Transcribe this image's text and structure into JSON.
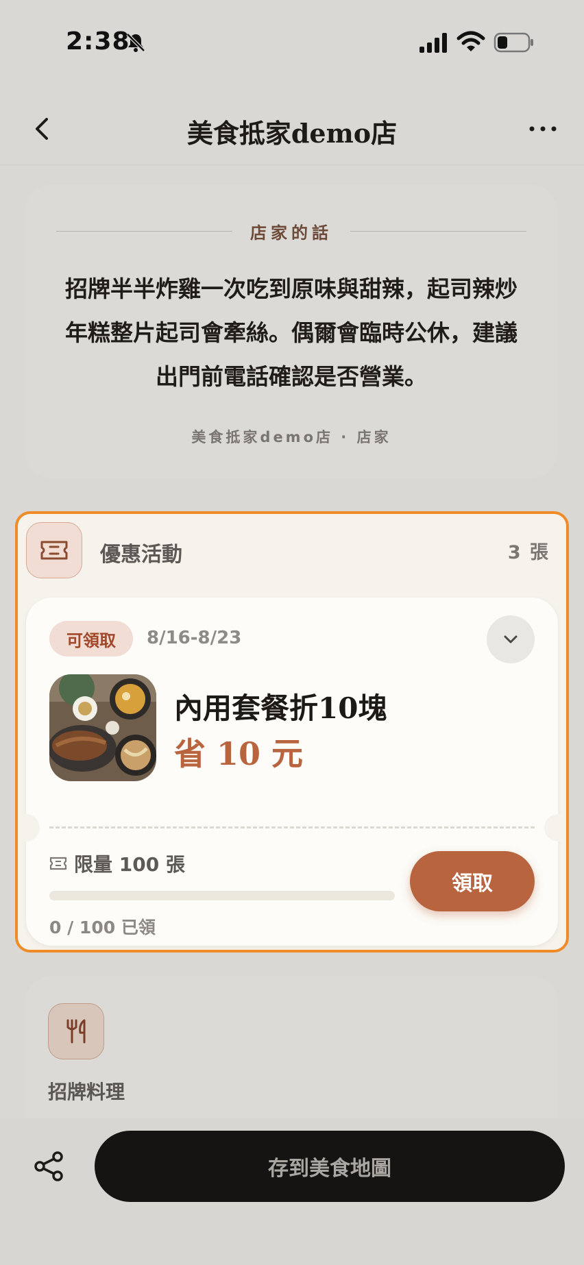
{
  "status_bar": {
    "time": "2:38"
  },
  "nav": {
    "title": "美食抵家demo店"
  },
  "owner_note": {
    "label": "店家的話",
    "text": "招牌半半炸雞一次吃到原味與甜辣，起司辣炒年糕整片起司會牽絲。偶爾會臨時公休，建議出門前電話確認是否營業。",
    "signature": "美食抵家demo店 · 店家"
  },
  "coupons": {
    "title": "優惠活動",
    "count": "3 張",
    "items": [
      {
        "status": "可領取",
        "date_range": "8/16-8/23",
        "title": "內用套餐折10塊",
        "saving": "省 10 元",
        "limit": "限量 100 張",
        "claimed_text": "0 / 100 已領",
        "claimed_fraction": 0,
        "claim_label": "領取"
      }
    ]
  },
  "signature_dishes": {
    "title": "招牌料理"
  },
  "bottom": {
    "save_label": "存到美食地圖"
  },
  "colors": {
    "accent": "#b8643f",
    "highlight_border": "#f08c28",
    "badge_bg": "#f1ddd3",
    "dark_button": "#161412"
  },
  "icons": {
    "back": "chevron-left-icon",
    "more": "more-icon",
    "coupon": "ticket-icon",
    "expand": "chevron-down-icon",
    "dish": "utensils-icon",
    "share": "share-icon"
  }
}
